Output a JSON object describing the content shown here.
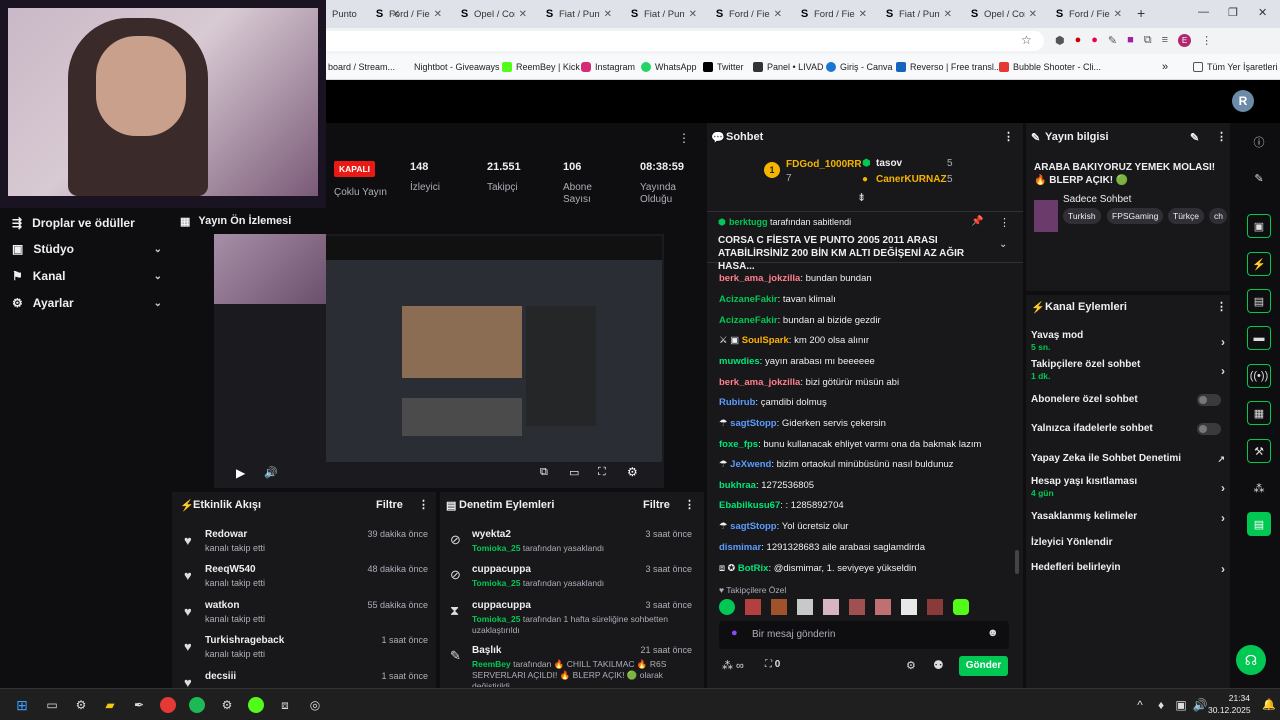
{
  "browser": {
    "tabs": [
      {
        "label": "Punto",
        "icon": "s-favicon"
      },
      {
        "label": "Ford / Fiesta",
        "icon": "s-favicon"
      },
      {
        "label": "Opel / Corsa",
        "icon": "s-favicon"
      },
      {
        "label": "Fiat / Punto",
        "icon": "s-favicon"
      },
      {
        "label": "Fiat / Punto",
        "icon": "s-favicon"
      },
      {
        "label": "Ford / Fiesta",
        "icon": "s-favicon"
      },
      {
        "label": "Ford / Fiesta",
        "icon": "s-favicon"
      },
      {
        "label": "Fiat / Punto",
        "icon": "s-favicon"
      },
      {
        "label": "Opel / Corsa",
        "icon": "s-favicon"
      },
      {
        "label": "Ford / Fiesta",
        "icon": "s-favicon"
      }
    ],
    "bookmarks": [
      {
        "label": "board / Stream..."
      },
      {
        "label": "Nightbot - Giveaways"
      },
      {
        "label": "ReemBey | Kick"
      },
      {
        "label": "Instagram"
      },
      {
        "label": "WhatsApp"
      },
      {
        "label": "Twitter"
      },
      {
        "label": "Panel • LIVAD"
      },
      {
        "label": "Giriş - Canva"
      },
      {
        "label": "Reverso | Free transl..."
      },
      {
        "label": "Bubble Shooter - Cli..."
      }
    ],
    "all_bookmarks": "Tüm Yer İşaretleri"
  },
  "stats": {
    "live_badge": "KAPALI",
    "live_sub": "Çoklu Yayın",
    "items": [
      {
        "value": "148",
        "label": "İzleyici"
      },
      {
        "value": "21.551",
        "label": "Takipçi"
      },
      {
        "value": "106",
        "label": "Abone Sayısı"
      },
      {
        "value": "08:38:59",
        "label": "Yayında Olduğu"
      }
    ]
  },
  "sidebar": {
    "items": [
      {
        "label": "Droplar ve ödüller"
      },
      {
        "label": "Stüdyo"
      },
      {
        "label": "Kanal"
      },
      {
        "label": "Ayarlar"
      }
    ]
  },
  "preview": {
    "title": "Yayın Ön İzlemesi"
  },
  "activity": {
    "title": "Etkinlik Akışı",
    "filter": "Filtre",
    "items": [
      {
        "name": "Redowar",
        "sub": "kanalı takip etti",
        "time": "39 dakika önce"
      },
      {
        "name": "ReeqW540",
        "sub": "kanalı takip etti",
        "time": "48 dakika önce"
      },
      {
        "name": "watkon",
        "sub": "kanalı takip etti",
        "time": "55 dakika önce"
      },
      {
        "name": "Turkishrageback",
        "sub": "kanalı takip etti",
        "time": "1 saat önce"
      },
      {
        "name": "decsiii",
        "sub": "",
        "time": "1 saat önce"
      }
    ]
  },
  "moderation": {
    "title": "Denetim Eylemleri",
    "filter": "Filtre",
    "items": [
      {
        "name": "wyekta2",
        "mod": "Tomioka_25",
        "sub": " tarafından yasaklandı",
        "time": "3 saat önce"
      },
      {
        "name": "cuppacuppa",
        "mod": "Tomioka_25",
        "sub": " tarafından yasaklandı",
        "time": "3 saat önce"
      },
      {
        "name": "cuppacuppa",
        "mod": "Tomioka_25",
        "sub": " tarafından 1 hafta süreliğine sohbetten uzaklaştırıldı",
        "time": "3 saat önce"
      },
      {
        "name": "Başlık",
        "mod": "ReemBey",
        "sub": " tarafından 🔥 CHILL TAKILMAC 🔥 R6S SERVERLARI AÇILDI! 🔥 BLERP AÇIK! 🟢 olarak değiştirildi",
        "time": "21 saat önce"
      }
    ]
  },
  "chat": {
    "title": "Sohbet",
    "leaderboard": [
      {
        "rank": "1",
        "name": "FDGod_1000RR",
        "points": "7"
      },
      {
        "rank": "",
        "name": "tasov",
        "points": "5"
      },
      {
        "rank": "",
        "name": "CanerKURNAZ",
        "points": "5"
      }
    ],
    "pinned_by": "berktugg",
    "pinned_label": " tarafından sabitlendi",
    "pinned_text": "CORSA C FİESTA VE PUNTO 2005 2011 ARASI ATABİLİRSİNİZ 200 BİN KM ALTI DEĞİŞENİ AZ AĞIR HASA...",
    "messages": [
      {
        "user": "berk_ama_jokzilla",
        "color": "#ff7f8e",
        "text": "bundan bundan"
      },
      {
        "user": "AcizaneFakir",
        "color": "#00c853",
        "text": "tavan klimalı"
      },
      {
        "user": "AcizaneFakir",
        "color": "#00c853",
        "text": "bundan al bizide gezdir"
      },
      {
        "user": "SoulSpark",
        "color": "#ffb300",
        "text": "km 200 olsa alınır"
      },
      {
        "user": "muwdies",
        "color": "#00e676",
        "text": "yayın arabası mı beeeeee"
      },
      {
        "user": "berk_ama_jokzilla",
        "color": "#ff7f8e",
        "text": "bizi götürür müsün abi"
      },
      {
        "user": "Rubirub",
        "color": "#5c9cff",
        "text": "çamdibi dolmuş"
      },
      {
        "user": "sagtStopp",
        "color": "#5c9cff",
        "text": "Giderken servis çekersin"
      },
      {
        "user": "foxe_fps",
        "color": "#00e676",
        "text": "bunu kullanacak ehliyet varmı ona da bakmak lazım"
      },
      {
        "user": "JeXwend",
        "color": "#5c9cff",
        "text": "bizim ortaokul minübüsünü nasıl buldunuz"
      },
      {
        "user": "bukhraa",
        "color": "#00e676",
        "text": "1272536805"
      },
      {
        "user": "Ebabilkusu67",
        "color": "#00e676",
        "text": ": 1285892704"
      },
      {
        "user": "sagtStopp",
        "color": "#5c9cff",
        "text": "Yol ücretsiz olur"
      },
      {
        "user": "dismimar",
        "color": "#5c9cff",
        "text": "1291328683 aile arabasi saglamdirda"
      },
      {
        "user": "BotRix",
        "color": "#00e676",
        "text": "@dismimar, 1. seviyeye yükseldin"
      }
    ],
    "followers_only": "Takipçilere Özel",
    "input_placeholder": "Bir mesaj gönderin",
    "points": "0",
    "send": "Gönder"
  },
  "stream_info": {
    "title": "Yayın bilgisi",
    "stream_title": "ARABA BAKIYORUZ YEMEK MOLASI! 🔥 BLERP AÇIK! 🟢",
    "category": "Sadece Sohbet",
    "tags": [
      "Turkish",
      "FPSGaming",
      "Türkçe",
      "ch"
    ]
  },
  "channel_actions": {
    "title": "Kanal Eylemleri",
    "items": [
      {
        "label": "Yavaş mod",
        "sub": "5 sn.",
        "control": "arrow"
      },
      {
        "label": "Takipçilere özel sohbet",
        "sub": "1 dk.",
        "control": "arrow"
      },
      {
        "label": "Abonelere özel sohbet",
        "sub": "",
        "control": "toggle"
      },
      {
        "label": "Yalnızca ifadelerle sohbet",
        "sub": "",
        "control": "toggle"
      },
      {
        "label": "Yapay Zeka ile Sohbet Denetimi",
        "sub": "",
        "control": "external"
      },
      {
        "label": "Hesap yaşı kısıtlaması",
        "sub": "4 gün",
        "control": "arrow"
      },
      {
        "label": "Yasaklanmış kelimeler",
        "sub": "",
        "control": "arrow"
      },
      {
        "label": "İzleyici Yönlendir",
        "sub": "",
        "control": "none"
      },
      {
        "label": "Hedefleri belirleyin",
        "sub": "",
        "control": "arrow"
      }
    ]
  },
  "clock": {
    "time": "21:34",
    "date": "30.12.2025"
  },
  "colors": {
    "accent": "#00c853",
    "brand": "#53fc18",
    "live": "#e91916"
  }
}
